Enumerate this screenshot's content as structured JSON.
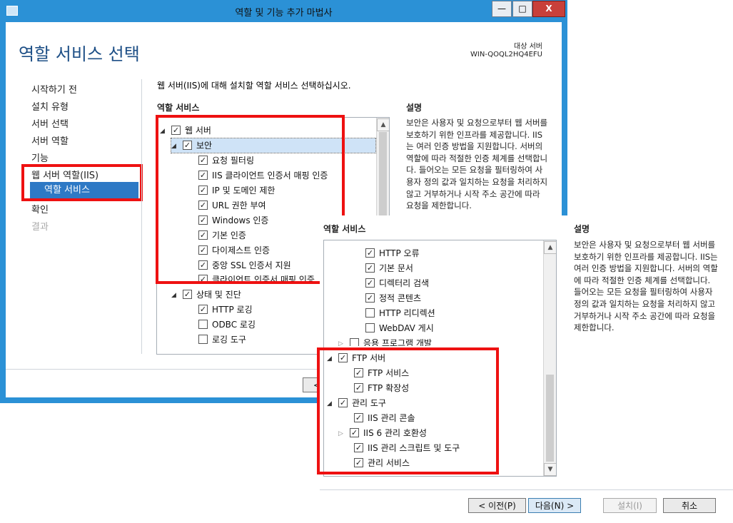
{
  "window_back": {
    "title": "역할 및 기능 추가 마법사",
    "controls": {
      "minimize": "—",
      "maximize": "□",
      "close": "X"
    },
    "heading": "역할 서비스 선택",
    "target_server_label": "대상 서버",
    "target_server_name": "WIN-QOQL2HQ4EFU",
    "nav": [
      "시작하기 전",
      "설치 유형",
      "서버 선택",
      "서버 역할",
      "기능",
      "웹 서버 역할(IIS)",
      "역할 서비스",
      "확인",
      "결과"
    ],
    "instruction": "웹 서버(IIS)에 대해 설치할 역할 서비스 선택하십시오.",
    "services_header": "역할 서비스",
    "description_header": "설명",
    "description": "보안은 사용자 및 요청으로부터 웹 서버를 보호하기 위한 인프라를 제공합니다. IIS는 여러 인증 방법을 지원합니다. 서버의 역할에 따라 적절한 인증 체계를 선택합니다. 들어오는 모든 요청을 필터링하여 사용자 정의 값과 일치하는 요청을 처리하지 않고 거부하거나 시작 주소 공간에 따라 요청을 제한합니다.",
    "tree": [
      {
        "label": "웹 서버",
        "checked": true
      },
      {
        "label": "보안",
        "checked": true
      },
      {
        "label": "요청 필터링",
        "checked": true
      },
      {
        "label": "IIS 클라이언트 인증서 매핑 인증",
        "checked": true
      },
      {
        "label": "IP 및 도메인 제한",
        "checked": true
      },
      {
        "label": "URL 권한 부여",
        "checked": true
      },
      {
        "label": "Windows 인증",
        "checked": true
      },
      {
        "label": "기본 인증",
        "checked": true
      },
      {
        "label": "다이제스트 인증",
        "checked": true
      },
      {
        "label": "중앙 SSL 인증서 지원",
        "checked": true
      },
      {
        "label": "클라이언트 인증서 매핑 인증",
        "checked": true
      },
      {
        "label": "상태 및 진단",
        "checked": true
      },
      {
        "label": "HTTP 로깅",
        "checked": true
      },
      {
        "label": "ODBC 로깅",
        "checked": false
      },
      {
        "label": "로깅 도구",
        "checked": false
      }
    ],
    "prev_button_fragment": "<"
  },
  "window_front": {
    "services_header": "역할 서비스",
    "description_header": "설명",
    "description": "보안은 사용자 및 요청으로부터 웹 서버를 보호하기 위한 인프라를 제공합니다. IIS는 여러 인증 방법을 지원합니다. 서버의 역할에 따라 적절한 인증 체계를 선택합니다. 들어오는 모든 요청을 필터링하여 사용자 정의 값과 일치하는 요청을 처리하지 않고 거부하거나 시작 주소 공간에 따라 요청을 제한합니다.",
    "tree": [
      {
        "label": "HTTP 오류",
        "checked": true
      },
      {
        "label": "기본 문서",
        "checked": true
      },
      {
        "label": "디렉터리 검색",
        "checked": true
      },
      {
        "label": "정적 콘텐츠",
        "checked": true
      },
      {
        "label": "HTTP 리디렉션",
        "checked": false
      },
      {
        "label": "WebDAV 게시",
        "checked": false
      },
      {
        "label": "응용 프로그램 개발",
        "checked": false
      },
      {
        "label": "FTP 서버",
        "checked": true
      },
      {
        "label": "FTP 서비스",
        "checked": true
      },
      {
        "label": "FTP 확장성",
        "checked": true
      },
      {
        "label": "관리 도구",
        "checked": true
      },
      {
        "label": "IIS 관리 콘솔",
        "checked": true
      },
      {
        "label": "IIS 6 관리 호환성",
        "checked": true
      },
      {
        "label": "IIS 관리 스크립트 및 도구",
        "checked": true
      },
      {
        "label": "관리 서비스",
        "checked": true
      }
    ],
    "buttons": {
      "prev": "< 이전(P)",
      "next": "다음(N) >",
      "install": "설치(I)",
      "cancel": "취소"
    }
  },
  "colors": {
    "window_border": "#2b91d6",
    "heading": "#1d4f86",
    "nav_active": "#2e79c5",
    "highlight_box": "#ee1111",
    "selection": "#cfe3f7"
  }
}
